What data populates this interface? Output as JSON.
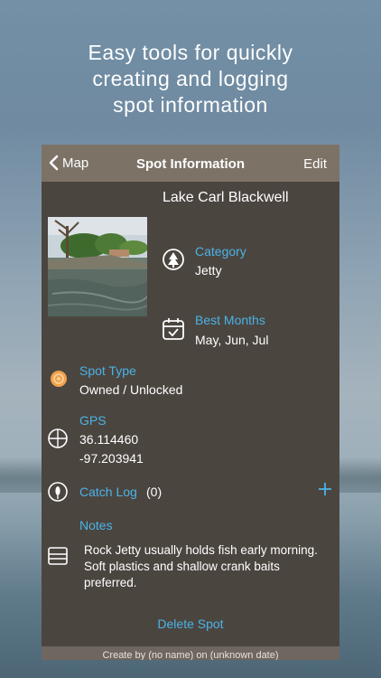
{
  "headline": {
    "line1": "Easy tools for quickly",
    "line2": "creating and logging",
    "line3": "spot information"
  },
  "navbar": {
    "back_label": "Map",
    "title": "Spot Information",
    "edit_label": "Edit"
  },
  "spot": {
    "name": "Lake Carl Blackwell",
    "category_label": "Category",
    "category_value": "Jetty",
    "best_months_label": "Best Months",
    "best_months_value": "May, Jun, Jul",
    "spot_type_label": "Spot Type",
    "spot_type_value": "Owned / Unlocked",
    "gps_label": "GPS",
    "gps_lat": "36.114460",
    "gps_lon": "-97.203941",
    "catch_log_label": "Catch Log",
    "catch_log_count": "(0)",
    "notes_label": "Notes",
    "notes_text": "Rock Jetty usually holds fish early morning. Soft plastics and shallow crank baits preferred.",
    "delete_label": "Delete Spot",
    "footer": "Create by (no name) on (unknown date)"
  },
  "colors": {
    "accent": "#4ab3e6",
    "card_bg": "#4b4540",
    "navbar_bg": "#7d7266",
    "spot_type_icon": "#f0a24b"
  },
  "icons": {
    "back": "chevron-left-icon",
    "category": "tree-icon",
    "best_months": "calendar-check-icon",
    "spot_type": "orange-dot-icon",
    "gps": "crosshair-icon",
    "catch_log": "lure-icon",
    "notes": "notes-icon",
    "add": "plus-icon"
  }
}
